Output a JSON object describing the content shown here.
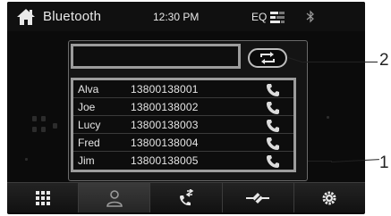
{
  "header": {
    "title": "Bluetooth",
    "time": "12:30 PM",
    "eq_label": "EQ",
    "icons": [
      "home-icon",
      "equalizer-icon",
      "bluetooth-icon"
    ]
  },
  "search": {
    "value": "",
    "switch_icon": "swap-arrows-icon"
  },
  "contacts": [
    {
      "name": "Alva",
      "number": "13800138001",
      "icon": "phone-call-icon"
    },
    {
      "name": "Joe",
      "number": "13800138002",
      "icon": "phone-call-icon"
    },
    {
      "name": "Lucy",
      "number": "13800138003",
      "icon": "phone-call-icon"
    },
    {
      "name": "Fred",
      "number": "13800138004",
      "icon": "phone-call-icon"
    },
    {
      "name": "Jim",
      "number": "13800138005",
      "icon": "phone-call-icon"
    }
  ],
  "tabs": [
    {
      "icon": "keypad-icon",
      "active": false
    },
    {
      "icon": "contacts-icon",
      "active": true
    },
    {
      "icon": "call-log-icon",
      "active": false
    },
    {
      "icon": "device-link-icon",
      "active": false
    },
    {
      "icon": "settings-icon",
      "active": false
    }
  ],
  "callouts": {
    "list": "1",
    "search": "2"
  },
  "colors": {
    "background": "#0b0b0b",
    "accent_border": "#9c9c9c",
    "text": "#e6e6e6"
  }
}
